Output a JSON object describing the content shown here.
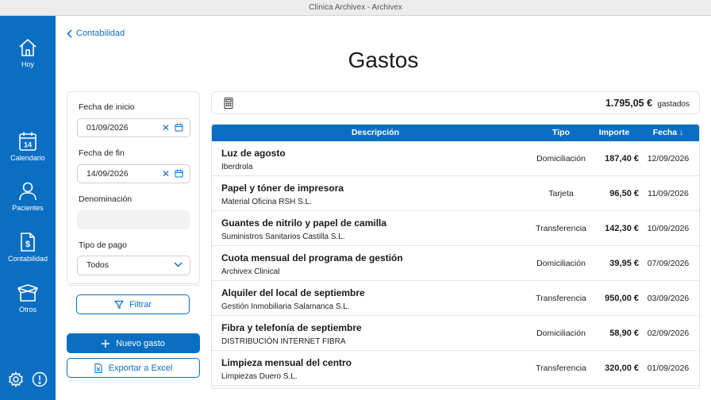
{
  "window": {
    "title": "Clínica Archivex - Archivex"
  },
  "sidebar": {
    "items": [
      {
        "label": "Hoy",
        "icon": "home-icon"
      },
      {
        "label": "Calendario",
        "icon": "calendar-icon",
        "badge": "14"
      },
      {
        "label": "Pacientes",
        "icon": "user-icon"
      },
      {
        "label": "Contabilidad",
        "icon": "invoice-dollar-icon"
      },
      {
        "label": "Otros",
        "icon": "open-box-icon"
      }
    ],
    "bottom_icons": [
      "gear-icon",
      "alert-icon"
    ]
  },
  "breadcrumb": {
    "label": "Contabilidad"
  },
  "page": {
    "title": "Gastos"
  },
  "filters": {
    "start_date_label": "Fecha de inicio",
    "start_date_value": "01/09/2026",
    "end_date_label": "Fecha de fin",
    "end_date_value": "14/09/2026",
    "name_label": "Denominación",
    "name_value": "",
    "payment_label": "Tipo de pago",
    "payment_value": "Todos",
    "filter_button": "Filtrar"
  },
  "actions": {
    "new_expense": "Nuevo gasto",
    "export_excel": "Exportar a Excel"
  },
  "summary": {
    "total": "1.795,05 €",
    "label": "gastados"
  },
  "table": {
    "columns": [
      "Descripción",
      "Tipo",
      "Importe",
      "Fecha ↓"
    ],
    "rows": [
      {
        "descripcion": "Luz de agosto",
        "proveedor": "Iberdrola",
        "tipo": "Domiciliación",
        "importe": "187,40 €",
        "fecha": "12/09/2026"
      },
      {
        "descripcion": "Papel y tóner de impresora",
        "proveedor": "Material Oficina RSH S.L.",
        "tipo": "Tarjeta",
        "importe": "96,50 €",
        "fecha": "11/09/2026"
      },
      {
        "descripcion": "Guantes de nitrilo y papel de camilla",
        "proveedor": "Suministros Sanitarios Castilla S.L.",
        "tipo": "Transferencia",
        "importe": "142,30 €",
        "fecha": "10/09/2026"
      },
      {
        "descripcion": "Cuota mensual del programa de gestión",
        "proveedor": "Archivex Clinical",
        "tipo": "Domiciliación",
        "importe": "39,95 €",
        "fecha": "07/09/2026"
      },
      {
        "descripcion": "Alquiler del local de septiembre",
        "proveedor": "Gestión Inmobiliaria Salamanca S.L.",
        "tipo": "Transferencia",
        "importe": "950,00 €",
        "fecha": "03/09/2026"
      },
      {
        "descripcion": "Fibra y telefonía de septiembre",
        "proveedor": "DISTRIBUCIÓN INTERNET FIBRA",
        "tipo": "Domiciliación",
        "importe": "58,90 €",
        "fecha": "02/09/2026"
      },
      {
        "descripcion": "Limpieza mensual del centro",
        "proveedor": "Limpiezas Duero S.L.",
        "tipo": "Transferencia",
        "importe": "320,00 €",
        "fecha": "01/09/2026"
      }
    ]
  },
  "colors": {
    "primary": "#0a6fc2",
    "sidebar_bg": "#0a6fc2"
  }
}
